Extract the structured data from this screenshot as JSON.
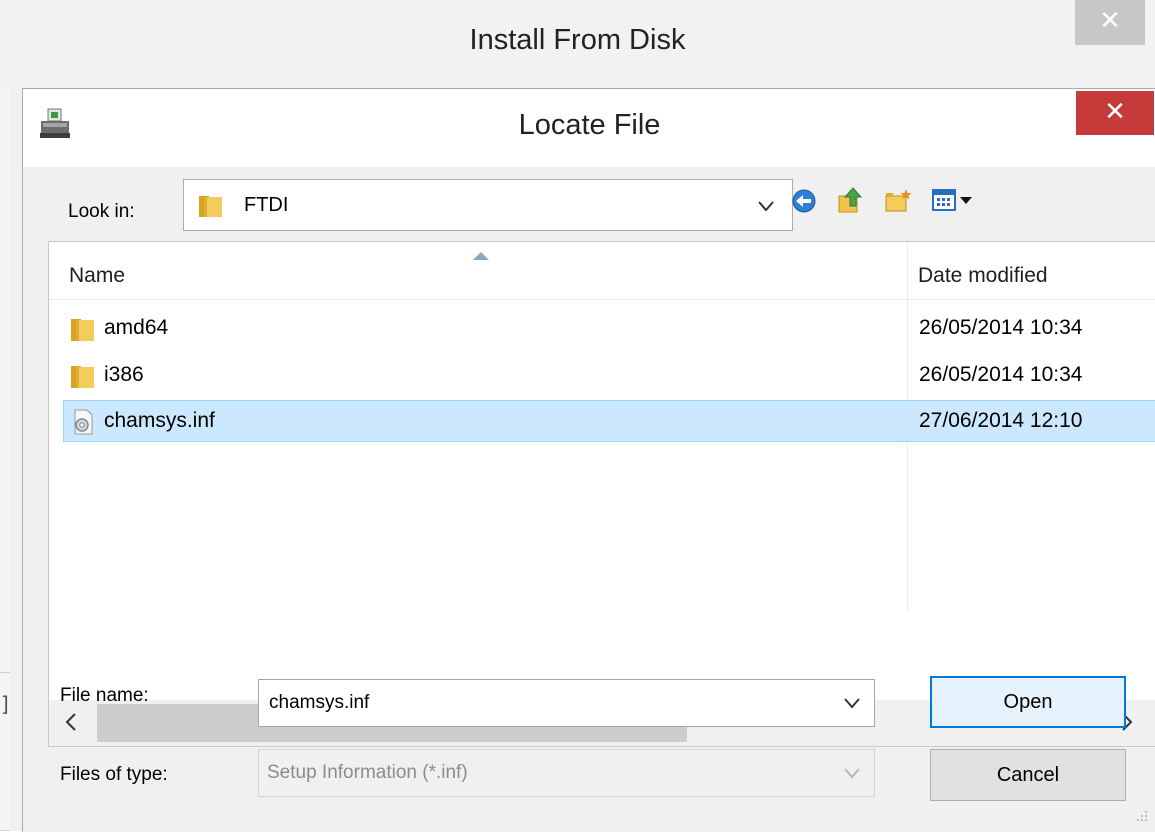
{
  "outer_window": {
    "title": "Install From Disk",
    "close_glyph": "✕",
    "left_bracket": "]"
  },
  "dialog": {
    "title": "Locate File",
    "close_glyph": "✕",
    "look_in": {
      "label": "Look in:",
      "value": "FTDI"
    },
    "toolbar_icons": [
      "back-icon",
      "up-folder-icon",
      "new-folder-icon",
      "view-menu-icon"
    ],
    "file_list": {
      "columns": [
        "Name",
        "Date modified"
      ],
      "rows": [
        {
          "name": "amd64",
          "date": "26/05/2014 10:34",
          "icon": "folder-icon",
          "selected": false
        },
        {
          "name": "i386",
          "date": "26/05/2014 10:34",
          "icon": "folder-icon",
          "selected": false
        },
        {
          "name": "chamsys.inf",
          "date": "27/06/2014 12:10",
          "icon": "settings-file-icon",
          "selected": true
        }
      ]
    },
    "file_name": {
      "label": "File name:",
      "value": "chamsys.inf"
    },
    "file_type": {
      "label": "Files of type:",
      "value": "Setup Information (*.inf)"
    },
    "buttons": {
      "open": "Open",
      "cancel": "Cancel"
    }
  },
  "colors": {
    "close_red": "#c73a3a",
    "selection": "#cce8ff",
    "accent": "#0078d7"
  }
}
